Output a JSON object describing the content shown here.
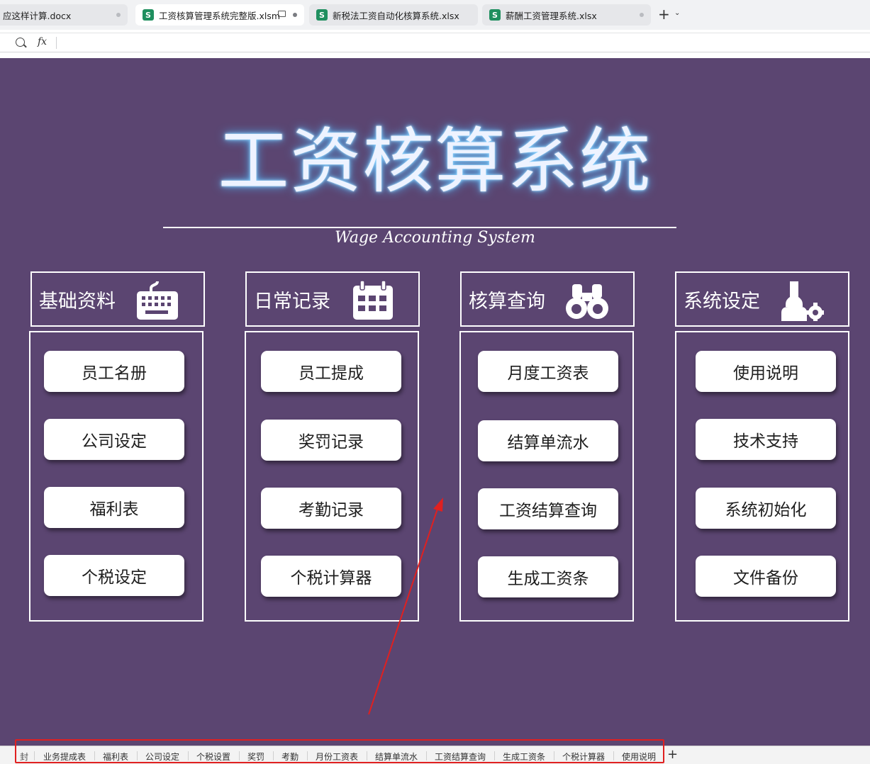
{
  "browser_tabs": [
    {
      "label": "应这样计算.docx",
      "icon": "",
      "active": false
    },
    {
      "label": "工资核算管理系统完整版.xlsm",
      "icon": "S",
      "active": true
    },
    {
      "label": "新税法工资自动化核算系统.xlsx",
      "icon": "S",
      "active": false
    },
    {
      "label": "薪酬工资管理系统.xlsx",
      "icon": "S",
      "active": false
    }
  ],
  "formula_bar": {
    "fx_label": "fx",
    "value": ""
  },
  "title": {
    "main": "工资核算系统",
    "subtitle": "Wage Accounting System"
  },
  "columns": [
    {
      "header": "基础资料",
      "icon": "keyboard-icon",
      "buttons": [
        "员工名册",
        "公司设定",
        "福利表",
        "个税设定"
      ]
    },
    {
      "header": "日常记录",
      "icon": "calendar-icon",
      "buttons": [
        "员工提成",
        "奖罚记录",
        "考勤记录",
        "个税计算器"
      ]
    },
    {
      "header": "核算查询",
      "icon": "binoculars-icon",
      "buttons": [
        "月度工资表",
        "结算单流水",
        "工资结算查询",
        "生成工资条"
      ]
    },
    {
      "header": "系统设定",
      "icon": "user-settings-icon",
      "buttons": [
        "使用说明",
        "技术支持",
        "系统初始化",
        "文件备份"
      ]
    }
  ],
  "sheet_tabs": [
    "业务提成表",
    "福利表",
    "公司设定",
    "个税设置",
    "奖罚",
    "考勤",
    "月份工资表",
    "结算单流水",
    "工资结算查询",
    "生成工资条",
    "个税计算器",
    "使用说明"
  ],
  "sheet_tab_partial": "封",
  "colors": {
    "background": "#5b4571",
    "annotation": "#e02020",
    "title_glow": "#4fb8ff"
  }
}
